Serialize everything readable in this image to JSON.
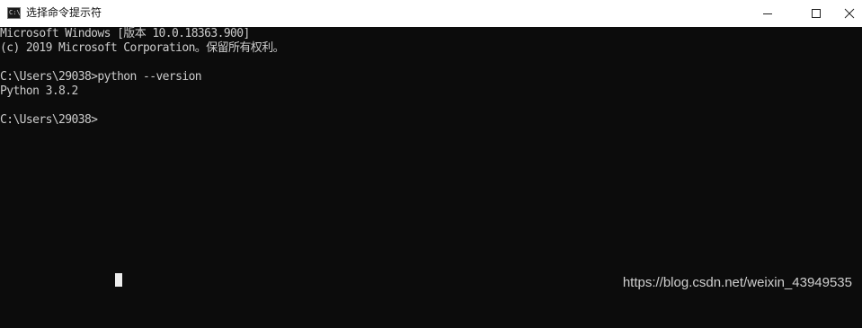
{
  "window": {
    "title": "选择命令提示符",
    "icon": "cmd-prompt-icon",
    "icon_glyph": "C:\\",
    "controls": {
      "minimize": "minimize-icon",
      "maximize": "maximize-icon",
      "close": "close-icon"
    }
  },
  "terminal": {
    "lines": [
      "Microsoft Windows [版本 10.0.18363.900]",
      "(c) 2019 Microsoft Corporation。保留所有权利。",
      "",
      "C:\\Users\\29038>python --version",
      "Python 3.8.2",
      "",
      "C:\\Users\\29038>"
    ]
  },
  "watermark": "https://blog.csdn.net/weixin_43949535",
  "colors": {
    "terminal_background": "#0c0c0c",
    "terminal_text": "#cccccc",
    "titlebar_background": "#ffffff"
  }
}
